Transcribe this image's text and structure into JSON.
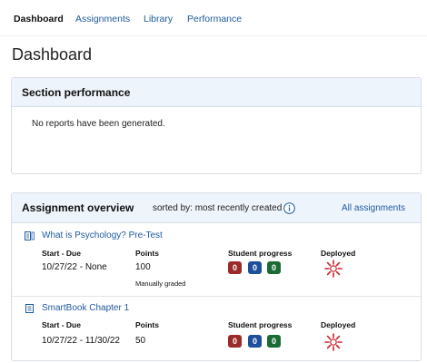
{
  "nav": {
    "items": [
      {
        "label": "Dashboard",
        "active": true
      },
      {
        "label": "Assignments",
        "active": false
      },
      {
        "label": "Library",
        "active": false
      },
      {
        "label": "Performance",
        "active": false
      }
    ]
  },
  "page_title": "Dashboard",
  "section_performance": {
    "title": "Section performance",
    "empty_message": "No reports have been generated."
  },
  "assignment_overview": {
    "title": "Assignment overview",
    "sorted_by": "sorted by: most recently created",
    "all_link": "All assignments",
    "columns": {
      "start_due": "Start - Due",
      "points": "Points",
      "student_progress": "Student progress",
      "deployed": "Deployed"
    },
    "assignments": [
      {
        "title": "What is Psychology? Pre-Test",
        "start_due": "10/27/22 - None",
        "points": "100",
        "note": "Manually graded",
        "progress": [
          "0",
          "0",
          "0"
        ]
      },
      {
        "title": "SmartBook Chapter 1",
        "start_due": "10/27/22 - 11/30/22",
        "points": "50",
        "note": "",
        "progress": [
          "0",
          "0",
          "0"
        ]
      }
    ]
  },
  "colors": {
    "link": "#1e5a9e",
    "header_bg": "#eef4fb",
    "badge_red": "#9b2a2a",
    "badge_blue": "#1f4f9c",
    "badge_green": "#1d6b34",
    "deployed_red": "#c8232c"
  },
  "icons": {
    "assignment_1": "test-document-icon",
    "assignment_2": "smartbook-icon",
    "info": "info-circle-icon",
    "deployed": "deployed-starburst-icon"
  }
}
